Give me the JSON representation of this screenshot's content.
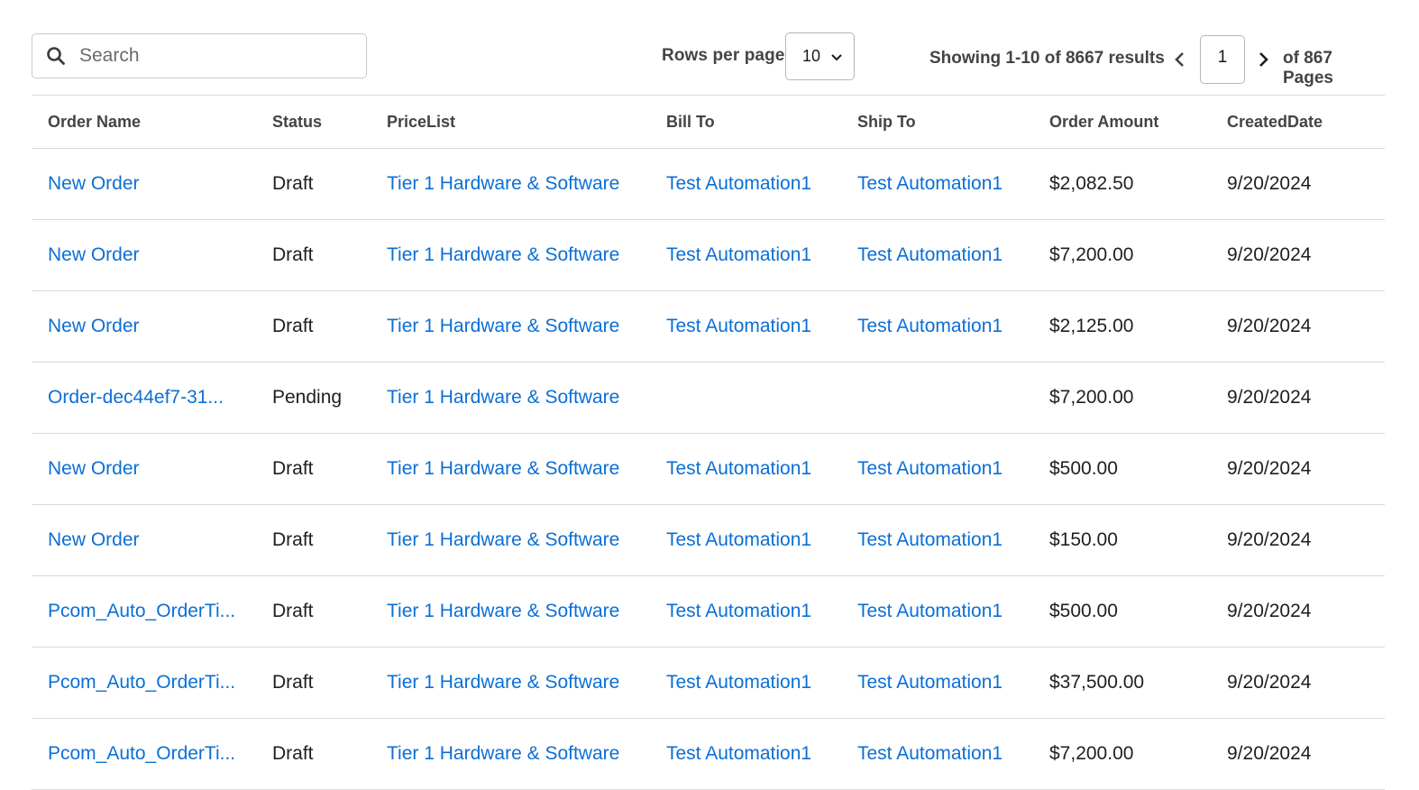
{
  "toolbar": {
    "search_placeholder": "Search",
    "rows_per_page_label": "Rows per page",
    "rows_per_page_value": "10",
    "showing_text": "Showing 1-10 of 8667 results",
    "current_page": "1",
    "of_pages_text": "of 867 Pages"
  },
  "colors": {
    "link": "#0b6fd6",
    "header_text": "#444444",
    "border": "#d9d9d9"
  },
  "table": {
    "columns": [
      "Order Name",
      "Status",
      "PriceList",
      "Bill To",
      "Ship To",
      "Order Amount",
      "CreatedDate"
    ],
    "rows": [
      {
        "order_name": "New Order",
        "status": "Draft",
        "pricelist": "Tier 1 Hardware & Software",
        "bill_to": "Test Automation1",
        "ship_to": "Test Automation1",
        "amount": "$2,082.50",
        "created": "9/20/2024"
      },
      {
        "order_name": "New Order",
        "status": "Draft",
        "pricelist": "Tier 1 Hardware & Software",
        "bill_to": "Test Automation1",
        "ship_to": "Test Automation1",
        "amount": "$7,200.00",
        "created": "9/20/2024"
      },
      {
        "order_name": "New Order",
        "status": "Draft",
        "pricelist": "Tier 1 Hardware & Software",
        "bill_to": "Test Automation1",
        "ship_to": "Test Automation1",
        "amount": "$2,125.00",
        "created": "9/20/2024"
      },
      {
        "order_name": "Order-dec44ef7-31...",
        "status": "Pending",
        "pricelist": "Tier 1 Hardware & Software",
        "bill_to": "",
        "ship_to": "",
        "amount": "$7,200.00",
        "created": "9/20/2024"
      },
      {
        "order_name": "New Order",
        "status": "Draft",
        "pricelist": "Tier 1 Hardware & Software",
        "bill_to": "Test Automation1",
        "ship_to": "Test Automation1",
        "amount": "$500.00",
        "created": "9/20/2024"
      },
      {
        "order_name": "New Order",
        "status": "Draft",
        "pricelist": "Tier 1 Hardware & Software",
        "bill_to": "Test Automation1",
        "ship_to": "Test Automation1",
        "amount": "$150.00",
        "created": "9/20/2024"
      },
      {
        "order_name": "Pcom_Auto_OrderTi...",
        "status": "Draft",
        "pricelist": "Tier 1 Hardware & Software",
        "bill_to": "Test Automation1",
        "ship_to": "Test Automation1",
        "amount": "$500.00",
        "created": "9/20/2024"
      },
      {
        "order_name": "Pcom_Auto_OrderTi...",
        "status": "Draft",
        "pricelist": "Tier 1 Hardware & Software",
        "bill_to": "Test Automation1",
        "ship_to": "Test Automation1",
        "amount": "$37,500.00",
        "created": "9/20/2024"
      },
      {
        "order_name": "Pcom_Auto_OrderTi...",
        "status": "Draft",
        "pricelist": "Tier 1 Hardware & Software",
        "bill_to": "Test Automation1",
        "ship_to": "Test Automation1",
        "amount": "$7,200.00",
        "created": "9/20/2024"
      }
    ]
  }
}
